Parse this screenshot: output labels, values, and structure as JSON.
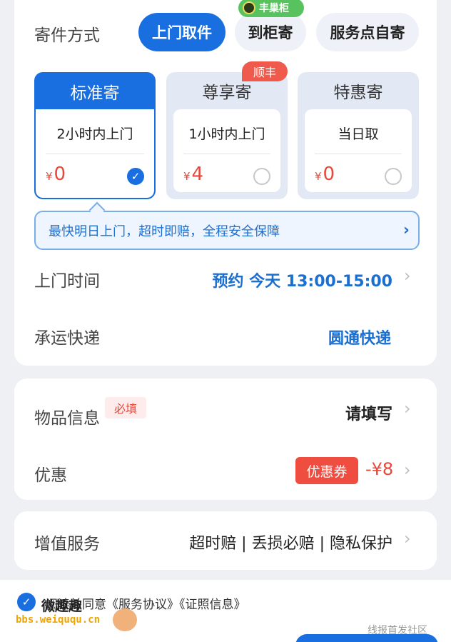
{
  "shipping": {
    "label": "寄件方式",
    "methods": [
      {
        "label": "上门取件",
        "active": true
      },
      {
        "label": "到柜寄",
        "active": false
      },
      {
        "label": "服务点自寄",
        "active": false
      }
    ],
    "cabinet_badge": "丰巢柜"
  },
  "options": [
    {
      "title": "标准寄",
      "desc": "2小时内上门",
      "currency": "¥",
      "price": "0",
      "selected": true
    },
    {
      "title": "尊享寄",
      "desc": "1小时内上门",
      "currency": "¥",
      "price": "4",
      "selected": false
    },
    {
      "title": "特惠寄",
      "desc": "当日取",
      "currency": "¥",
      "price": "0",
      "selected": false
    }
  ],
  "premium_badge": "顺丰",
  "tip": "最快明日上门，超时即赔，全程安全保障",
  "pickup": {
    "label": "上门时间",
    "value": "预约 今天 13:00-15:00"
  },
  "carrier": {
    "label": "承运快递",
    "value": "圆通快递"
  },
  "item": {
    "label": "物品信息",
    "required": "必填",
    "value": "请填写"
  },
  "promo": {
    "label": "优惠",
    "coupon": "优惠券",
    "amount": "-¥8"
  },
  "value_added": {
    "label": "增值服务",
    "value": "超时赔 | 丢损必赔 | 隐私保护"
  },
  "agreement": {
    "text": "阅读并同意《服务协议》《证照信息》"
  },
  "watermark": {
    "line1": "微趣趣",
    "line2": "bbs.weiququ.cn",
    "right": "线报首发社区"
  },
  "colors": {
    "primary": "#1a6fe0",
    "price": "#e8483a",
    "badge_green": "#58c35e"
  }
}
